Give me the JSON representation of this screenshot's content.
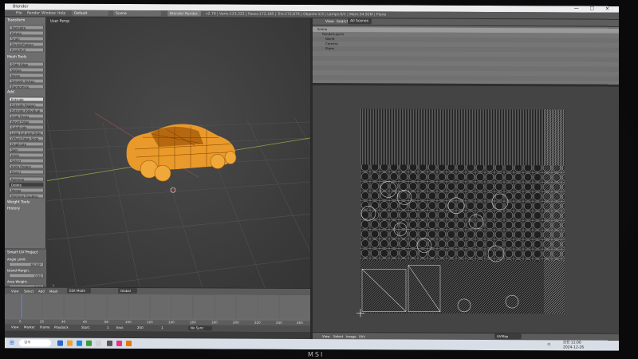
{
  "window": {
    "title": "Blender",
    "controls": "— ☐ ✕"
  },
  "menu": [
    "File",
    "Render",
    "Window",
    "Help"
  ],
  "header": {
    "layout": "Default",
    "scene": "Scene",
    "engine": "Blender Render",
    "stats": "v2.79 | Verts:123,322 | Faces:172,185 | Tris:172,879 | Objects:1/3 | Lamps:0/1 | Mem:34.92M | Plane"
  },
  "toolshelf": {
    "sections": [
      "Transform",
      "Mesh Tools",
      "Add",
      "Weight Tools",
      "History"
    ],
    "buttons": [
      "Translate",
      "Rotate",
      "Scale",
      "Shrink/Flatten",
      "Push/Pull",
      "Slide Edge",
      "Vertex",
      "Noise",
      "Smooth Vertex",
      "Randomize",
      "Extrude",
      "Extrude Region",
      "Extrude Individual",
      "Inset Faces",
      "Bevel Edge",
      "Subdivide",
      "Loop Cut and Slide",
      "Offset Edge Slide",
      "Duplicate",
      "Spin",
      "Knife",
      "Select",
      "Knife Project",
      "Bisect",
      "Remove",
      "Delete",
      "Merge",
      "Remove Doubles"
    ],
    "active_button": "Extrude",
    "operator_panel": {
      "title": "Smart UV Project",
      "angle_label": "Angle Limit:",
      "angle_value": "66.00°",
      "island_label": "Island Margin:",
      "island_value": "0.00",
      "area_label": "Area Weight:",
      "area_value": "0.00",
      "correct_aspect": "Correct Aspect",
      "stretch": "Stretch to UV B"
    }
  },
  "viewport": {
    "label": "User Persp",
    "footer": [
      "View",
      "Select",
      "Add",
      "Mesh",
      "Edit Mode",
      "Global"
    ],
    "corner_text": "(1) ..."
  },
  "timeline": {
    "footer": [
      "View",
      "Marker",
      "Frame",
      "Playback"
    ],
    "start_label": "Start:",
    "start_value": "1",
    "end_label": "End:",
    "end_value": "250",
    "current": "1",
    "sync": "No Sync",
    "ticks": [
      "0",
      "20",
      "40",
      "60",
      "80",
      "100",
      "120",
      "140",
      "160",
      "180",
      "200",
      "220",
      "240",
      "260"
    ]
  },
  "outliner": {
    "header": [
      "View",
      "Search",
      "All Scenes"
    ],
    "rows": [
      "Scene",
      "RenderLayers",
      "World",
      "Camera",
      "Plane"
    ]
  },
  "uv_editor": {
    "footer": [
      "View",
      "Select",
      "Image",
      "UVs",
      "UVMap"
    ]
  },
  "taskbar": {
    "search": "검색",
    "clock_time": "오전 11:00",
    "clock_date": "2024-12-26",
    "lang": "가"
  },
  "monitor_brand": "MSI",
  "colors": {
    "object": "#f0a030",
    "active_button": "#d9d9d9"
  }
}
